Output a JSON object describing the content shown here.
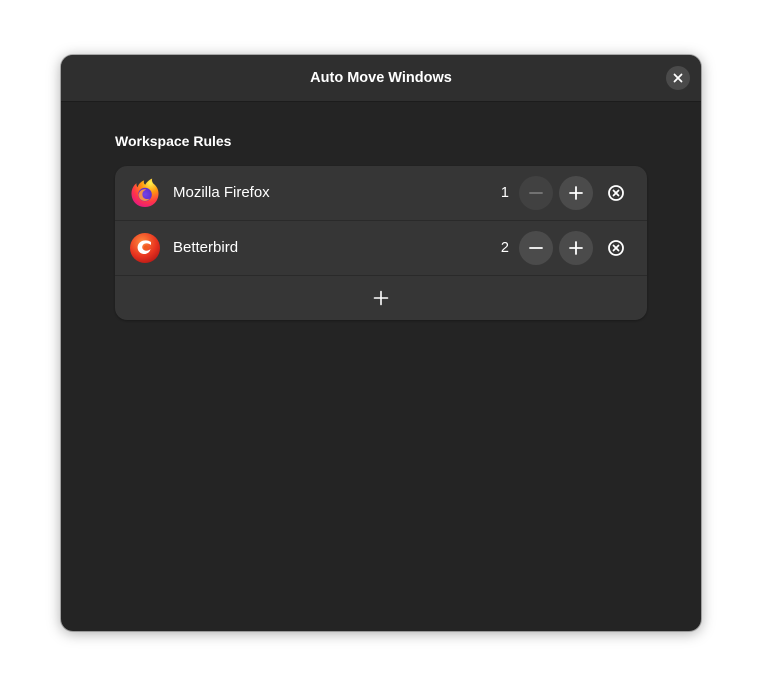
{
  "window": {
    "title": "Auto Move Windows"
  },
  "section": {
    "title": "Workspace Rules"
  },
  "rules": [
    {
      "app_name": "Mozilla Firefox",
      "workspace": "1",
      "icon": "firefox-icon",
      "decrement_enabled": false
    },
    {
      "app_name": "Betterbird",
      "workspace": "2",
      "icon": "betterbird-icon",
      "decrement_enabled": true
    }
  ],
  "colors": {
    "window_bg": "#242424",
    "titlebar_bg": "#2f2f2f",
    "list_bg": "#363636",
    "button_bg": "#4b4b4b",
    "text": "#ffffff"
  }
}
